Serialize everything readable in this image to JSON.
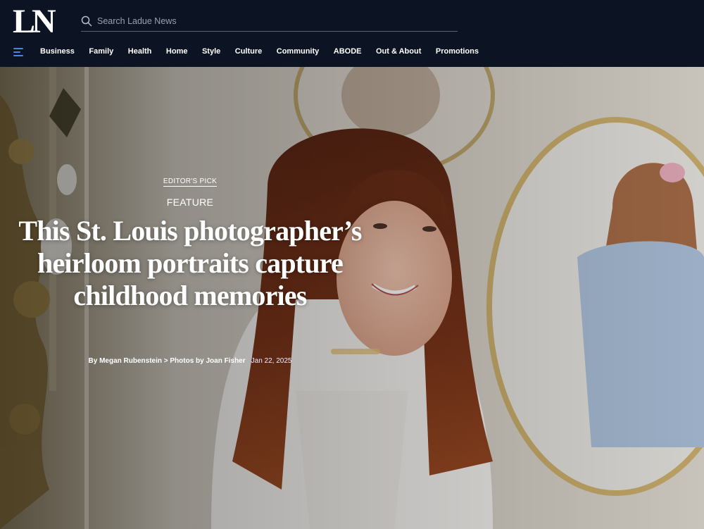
{
  "site": {
    "logo": "LN"
  },
  "search": {
    "placeholder": "Search Ladue News"
  },
  "nav": {
    "menu_icon": "hamburger-menu-icon",
    "items": [
      "Business",
      "Family",
      "Health",
      "Home",
      "Style",
      "Culture",
      "Community",
      "ABODE",
      "Out & About",
      "Promotions"
    ]
  },
  "hero": {
    "kicker": "EDITOR'S PICK",
    "section": "FEATURE",
    "headline": "This St. Louis photographer’s heirloom portraits capture childhood memories",
    "byline": "By Megan Rubenstein > Photos by Joan Fisher",
    "date": "Jan 22, 2025"
  },
  "colors": {
    "header_bg": "#0c1322",
    "menu_accent": "#4a86d8"
  }
}
